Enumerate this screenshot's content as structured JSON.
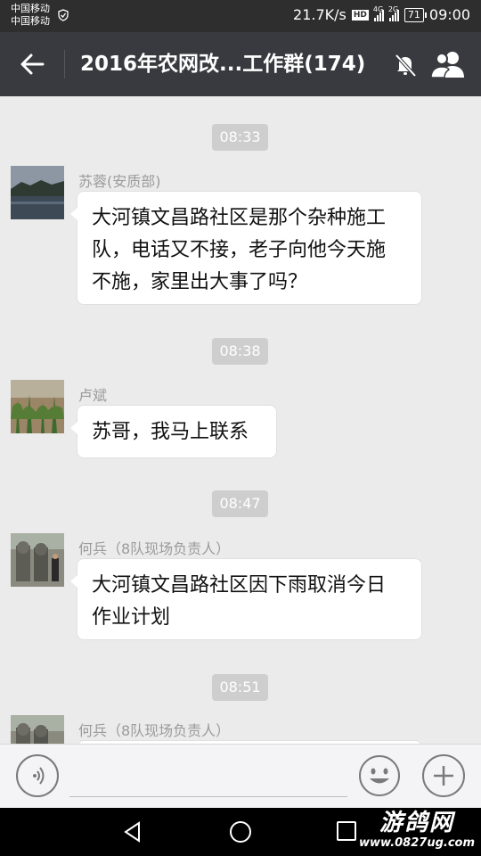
{
  "status_bar": {
    "carrier1": "中国移动",
    "carrier2": "中国移动",
    "speed": "21.7K/s",
    "hd": "HD",
    "net1": "4G",
    "net2": "2G",
    "battery": "71",
    "time": "09:00"
  },
  "header": {
    "title": "2016年农网改...工作群(174)",
    "back_icon": "arrow-left-icon",
    "mute_icon": "bell-off-icon",
    "members_icon": "group-people-icon"
  },
  "messages": [
    {
      "time": "08:33",
      "sender": "苏蓉(安质部)",
      "lines": [
        "大河镇文昌路社区是那个杂种施工",
        "队，电话又不接，老子向他今天施",
        "不施，家里出大事了吗？"
      ]
    },
    {
      "time": "08:38",
      "sender": "卢斌",
      "lines": [
        "苏哥，我马上联系"
      ]
    },
    {
      "time": "08:47",
      "sender": "何兵（8队现场负责人）",
      "lines": [
        "大河镇文昌路社区因下雨取消今日",
        "作业计划"
      ]
    },
    {
      "time": "08:51",
      "sender": "何兵（8队现场负责人）",
      "lines": []
    }
  ],
  "input_bar": {
    "voice_icon": "voice-icon",
    "emoji_icon": "emoji-icon",
    "plus_icon": "plus-icon"
  },
  "watermark": {
    "logo": "游鸽网",
    "url": "www.0827ug.com"
  },
  "colors": {
    "header_bg": "#393a3f",
    "status_bg": "#2e2e2e",
    "chat_bg": "#ebebeb",
    "bubble_bg": "#ffffff",
    "time_bg": "#cecece"
  }
}
